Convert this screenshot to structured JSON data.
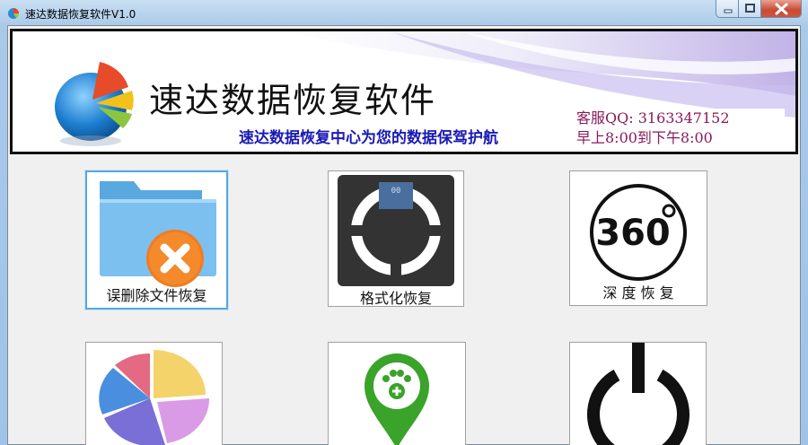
{
  "window": {
    "title": "速达数据恢复软件V1.0",
    "icon": "app-pie-icon",
    "controls": [
      "minimize-icon",
      "maximize-icon",
      "close-icon"
    ]
  },
  "banner": {
    "title": "速达数据恢复软件",
    "slogan": "速达数据恢复中心为您的数据保驾护航",
    "contact_qq": "客服QQ: 3163347152",
    "contact_hours": "早上8:00到下午8:00"
  },
  "tiles": [
    {
      "label": "误删除文件恢复",
      "icon": "folder-delete-icon",
      "selected": true
    },
    {
      "label": "格式化恢复",
      "icon": "scale-icon",
      "selected": false
    },
    {
      "label": "深 度 恢 复",
      "icon": "360-icon",
      "selected": false
    },
    {
      "label": "",
      "icon": "pie-chart-icon",
      "selected": false
    },
    {
      "label": "",
      "icon": "map-pin-paw-icon",
      "selected": false
    },
    {
      "label": "",
      "icon": "power-icon",
      "selected": false
    }
  ],
  "colors": {
    "slogan": "#1a1ab4",
    "contact": "#8a1a5a",
    "selection": "#56a8e0",
    "close_button": "#c74a36"
  }
}
